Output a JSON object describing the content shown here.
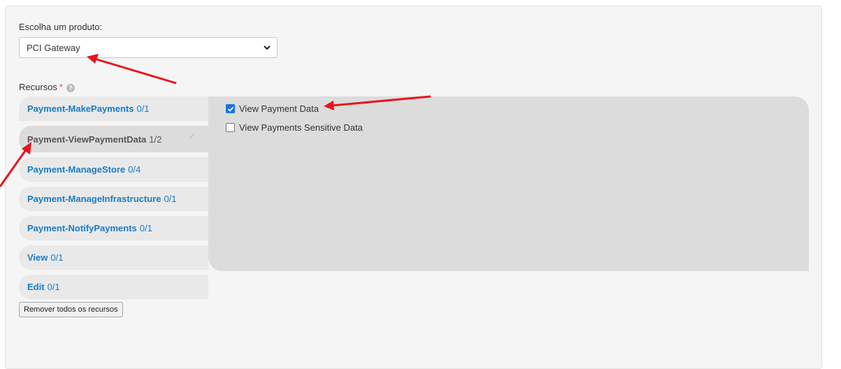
{
  "product": {
    "label": "Escolha um produto:",
    "selected": "PCI Gateway",
    "chevron_icon": "chevron-down-icon"
  },
  "resources": {
    "label": "Recursos",
    "required_mark": "*",
    "help_icon": "question-circle-icon",
    "help_glyph": "?"
  },
  "tabs": [
    {
      "name": "Payment-MakePayments",
      "count": "0/1"
    },
    {
      "name": "Payment-ViewPaymentData",
      "count": "1/2",
      "check": "✔"
    },
    {
      "name": "Payment-ManageStore",
      "count": "0/4"
    },
    {
      "name": "Payment-ManageInfrastructure",
      "count": "0/1"
    },
    {
      "name": "Payment-NotifyPayments",
      "count": "0/1"
    },
    {
      "name": "View",
      "count": "0/1"
    },
    {
      "name": "Edit",
      "count": "0/1"
    }
  ],
  "permissions": [
    {
      "label": "View Payment Data",
      "checked": true
    },
    {
      "label": "View Payments Sensitive Data",
      "checked": false
    }
  ],
  "remove_button": "Remover todos os recursos",
  "colors": {
    "link": "#1a7bc4",
    "checkbox": "#1a73e8",
    "annotation_arrow": "#e8141c"
  }
}
